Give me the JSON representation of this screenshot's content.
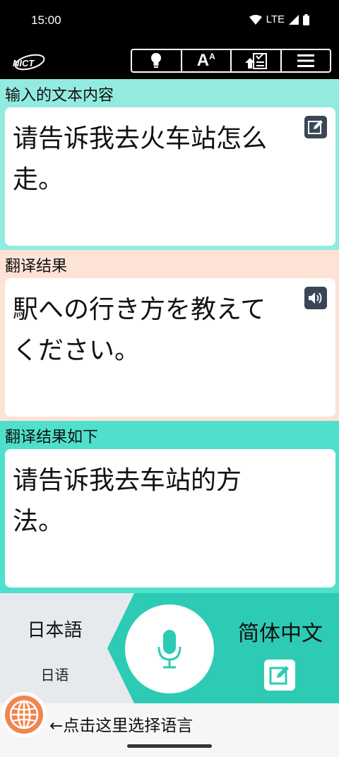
{
  "status": {
    "time": "15:00",
    "network": "LTE"
  },
  "header": {
    "logo_text": "NICT",
    "toolbar": [
      {
        "name": "tips",
        "icon": "lightbulb-icon"
      },
      {
        "name": "font-size",
        "icon": "font-size-icon",
        "label": "A",
        "sup": "A"
      },
      {
        "name": "history",
        "icon": "list-upload-icon"
      },
      {
        "name": "menu",
        "icon": "hamburger-menu-icon"
      }
    ]
  },
  "input_section": {
    "label": "输入的文本内容",
    "text": "请告诉我去火车站怎么走。"
  },
  "translation_section": {
    "label": "翻译结果",
    "text": "駅への行き方を教えてください。"
  },
  "back_translation_section": {
    "label": "翻译结果如下",
    "text": "请告诉我去车站的方法。"
  },
  "bottom_panel": {
    "source_language": "日本語",
    "source_language_sub": "日语",
    "target_language": "简体中文"
  },
  "language_hint": "←点击这里选择语言",
  "colors": {
    "input_bg": "#93ebdf",
    "translation_bg": "#fde3d6",
    "back_bg": "#4fe0cc",
    "accent": "#2ecbb4",
    "globe": "#f0854f",
    "icon_dark": "#3a4656"
  }
}
